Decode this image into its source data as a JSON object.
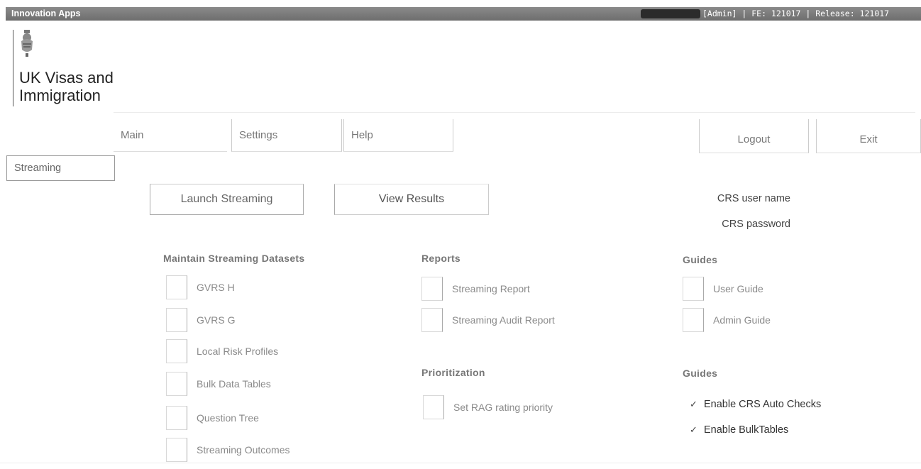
{
  "topbar": {
    "app_title": "Innovation Apps",
    "status": "[Admin] | FE: 121017 | Release: 121017"
  },
  "brand": {
    "line1": "UK Visas and",
    "line2": "Immigration"
  },
  "nav": {
    "main": "Main",
    "settings": "Settings",
    "help": "Help",
    "logout": "Logout",
    "exit": "Exit"
  },
  "subnav": {
    "streaming": "Streaming"
  },
  "actions": {
    "launch": "Launch Streaming",
    "view": "View Results"
  },
  "crs": {
    "user_label": "CRS user name",
    "password_label": "CRS password"
  },
  "datasets": {
    "heading": "Maintain Streaming Datasets",
    "items": [
      "GVRS H",
      "GVRS G",
      "Local Risk Profiles",
      "Bulk Data Tables",
      "Question Tree",
      "Streaming Outcomes"
    ]
  },
  "reports": {
    "heading": "Reports",
    "items": [
      "Streaming Report",
      "Streaming Audit Report"
    ]
  },
  "prioritization": {
    "heading": "Prioritization",
    "items": [
      "Set RAG rating priority"
    ]
  },
  "guides": {
    "heading": "Guides",
    "items": [
      "User Guide",
      "Admin Guide"
    ]
  },
  "settings_block": {
    "heading": "Guides",
    "items": [
      {
        "label": "Enable CRS Auto Checks",
        "checked": true
      },
      {
        "label": "Enable BulkTables",
        "checked": true
      }
    ],
    "tick_glyph": "✓"
  }
}
